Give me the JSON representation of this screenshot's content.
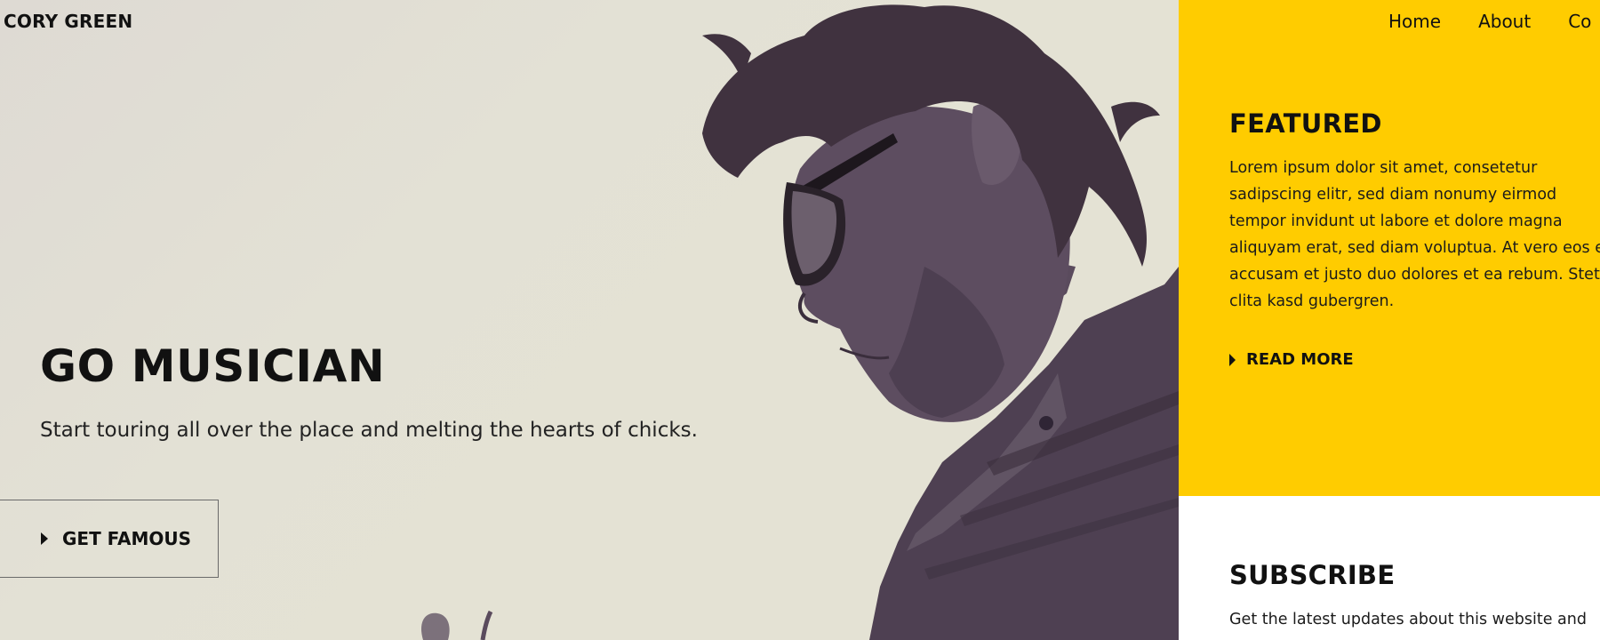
{
  "brand": {
    "name": "CORY GREEN"
  },
  "nav": {
    "items": [
      "Home",
      "About",
      "Co"
    ]
  },
  "hero": {
    "title": "GO MUSICIAN",
    "subtitle": "Start touring all over the place and melting the hearts of chicks.",
    "cta_label": "GET FAMOUS",
    "photo_icon": "musician-photo"
  },
  "featured": {
    "heading": "FEATURED",
    "body": "Lorem ipsum dolor sit amet, consetetur sadipscing elitr, sed diam nonumy eirmod tempor invidunt ut labore et dolore magna aliquyam erat, sed diam voluptua. At vero eos et accusam et justo duo dolores et ea rebum. Stet clita kasd gubergren.",
    "read_more_label": "READ MORE"
  },
  "subscribe": {
    "heading": "SUBSCRIBE",
    "body": "Get the latest updates about this website and"
  },
  "colors": {
    "accent": "#ffcc00",
    "hero_bg": "#e3e1d5",
    "text": "#111111",
    "photo_tone": "#4e4052"
  }
}
